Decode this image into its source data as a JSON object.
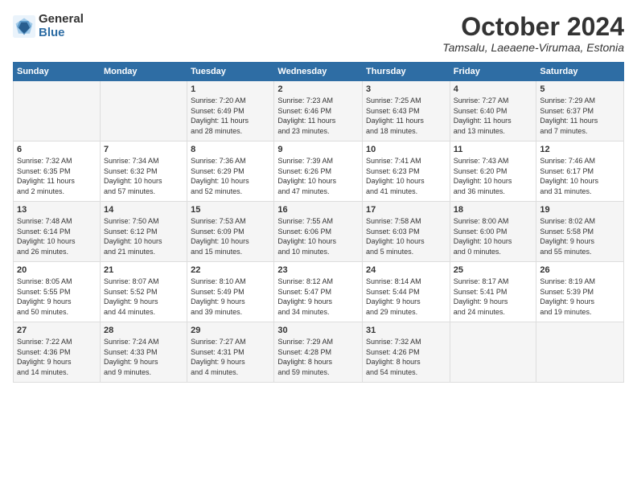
{
  "header": {
    "logo_general": "General",
    "logo_blue": "Blue",
    "month_title": "October 2024",
    "location": "Tamsalu, Laeaene-Virumaa, Estonia"
  },
  "days_of_week": [
    "Sunday",
    "Monday",
    "Tuesday",
    "Wednesday",
    "Thursday",
    "Friday",
    "Saturday"
  ],
  "weeks": [
    [
      {
        "day": "",
        "info": ""
      },
      {
        "day": "",
        "info": ""
      },
      {
        "day": "1",
        "info": "Sunrise: 7:20 AM\nSunset: 6:49 PM\nDaylight: 11 hours\nand 28 minutes."
      },
      {
        "day": "2",
        "info": "Sunrise: 7:23 AM\nSunset: 6:46 PM\nDaylight: 11 hours\nand 23 minutes."
      },
      {
        "day": "3",
        "info": "Sunrise: 7:25 AM\nSunset: 6:43 PM\nDaylight: 11 hours\nand 18 minutes."
      },
      {
        "day": "4",
        "info": "Sunrise: 7:27 AM\nSunset: 6:40 PM\nDaylight: 11 hours\nand 13 minutes."
      },
      {
        "day": "5",
        "info": "Sunrise: 7:29 AM\nSunset: 6:37 PM\nDaylight: 11 hours\nand 7 minutes."
      }
    ],
    [
      {
        "day": "6",
        "info": "Sunrise: 7:32 AM\nSunset: 6:35 PM\nDaylight: 11 hours\nand 2 minutes."
      },
      {
        "day": "7",
        "info": "Sunrise: 7:34 AM\nSunset: 6:32 PM\nDaylight: 10 hours\nand 57 minutes."
      },
      {
        "day": "8",
        "info": "Sunrise: 7:36 AM\nSunset: 6:29 PM\nDaylight: 10 hours\nand 52 minutes."
      },
      {
        "day": "9",
        "info": "Sunrise: 7:39 AM\nSunset: 6:26 PM\nDaylight: 10 hours\nand 47 minutes."
      },
      {
        "day": "10",
        "info": "Sunrise: 7:41 AM\nSunset: 6:23 PM\nDaylight: 10 hours\nand 41 minutes."
      },
      {
        "day": "11",
        "info": "Sunrise: 7:43 AM\nSunset: 6:20 PM\nDaylight: 10 hours\nand 36 minutes."
      },
      {
        "day": "12",
        "info": "Sunrise: 7:46 AM\nSunset: 6:17 PM\nDaylight: 10 hours\nand 31 minutes."
      }
    ],
    [
      {
        "day": "13",
        "info": "Sunrise: 7:48 AM\nSunset: 6:14 PM\nDaylight: 10 hours\nand 26 minutes."
      },
      {
        "day": "14",
        "info": "Sunrise: 7:50 AM\nSunset: 6:12 PM\nDaylight: 10 hours\nand 21 minutes."
      },
      {
        "day": "15",
        "info": "Sunrise: 7:53 AM\nSunset: 6:09 PM\nDaylight: 10 hours\nand 15 minutes."
      },
      {
        "day": "16",
        "info": "Sunrise: 7:55 AM\nSunset: 6:06 PM\nDaylight: 10 hours\nand 10 minutes."
      },
      {
        "day": "17",
        "info": "Sunrise: 7:58 AM\nSunset: 6:03 PM\nDaylight: 10 hours\nand 5 minutes."
      },
      {
        "day": "18",
        "info": "Sunrise: 8:00 AM\nSunset: 6:00 PM\nDaylight: 10 hours\nand 0 minutes."
      },
      {
        "day": "19",
        "info": "Sunrise: 8:02 AM\nSunset: 5:58 PM\nDaylight: 9 hours\nand 55 minutes."
      }
    ],
    [
      {
        "day": "20",
        "info": "Sunrise: 8:05 AM\nSunset: 5:55 PM\nDaylight: 9 hours\nand 50 minutes."
      },
      {
        "day": "21",
        "info": "Sunrise: 8:07 AM\nSunset: 5:52 PM\nDaylight: 9 hours\nand 44 minutes."
      },
      {
        "day": "22",
        "info": "Sunrise: 8:10 AM\nSunset: 5:49 PM\nDaylight: 9 hours\nand 39 minutes."
      },
      {
        "day": "23",
        "info": "Sunrise: 8:12 AM\nSunset: 5:47 PM\nDaylight: 9 hours\nand 34 minutes."
      },
      {
        "day": "24",
        "info": "Sunrise: 8:14 AM\nSunset: 5:44 PM\nDaylight: 9 hours\nand 29 minutes."
      },
      {
        "day": "25",
        "info": "Sunrise: 8:17 AM\nSunset: 5:41 PM\nDaylight: 9 hours\nand 24 minutes."
      },
      {
        "day": "26",
        "info": "Sunrise: 8:19 AM\nSunset: 5:39 PM\nDaylight: 9 hours\nand 19 minutes."
      }
    ],
    [
      {
        "day": "27",
        "info": "Sunrise: 7:22 AM\nSunset: 4:36 PM\nDaylight: 9 hours\nand 14 minutes."
      },
      {
        "day": "28",
        "info": "Sunrise: 7:24 AM\nSunset: 4:33 PM\nDaylight: 9 hours\nand 9 minutes."
      },
      {
        "day": "29",
        "info": "Sunrise: 7:27 AM\nSunset: 4:31 PM\nDaylight: 9 hours\nand 4 minutes."
      },
      {
        "day": "30",
        "info": "Sunrise: 7:29 AM\nSunset: 4:28 PM\nDaylight: 8 hours\nand 59 minutes."
      },
      {
        "day": "31",
        "info": "Sunrise: 7:32 AM\nSunset: 4:26 PM\nDaylight: 8 hours\nand 54 minutes."
      },
      {
        "day": "",
        "info": ""
      },
      {
        "day": "",
        "info": ""
      }
    ]
  ]
}
